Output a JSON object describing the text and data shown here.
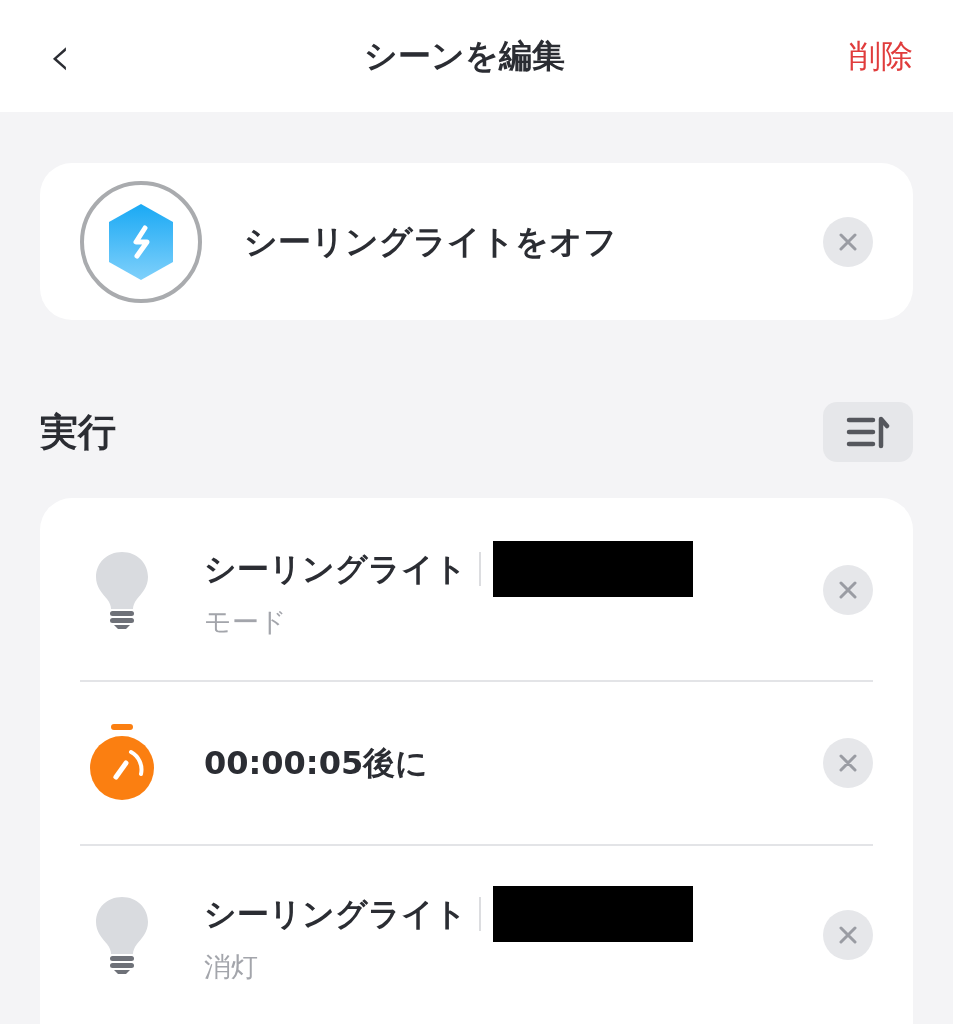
{
  "header": {
    "back": "‹",
    "title": "シーンを編集",
    "delete": "削除"
  },
  "scene": {
    "name": "シーリングライトをオフ"
  },
  "section": {
    "title": "実行"
  },
  "actions": [
    {
      "kind": "device",
      "title": "シーリングライト",
      "subtitle": "モード",
      "redacted": true
    },
    {
      "kind": "delay",
      "title": "00:00:05後に"
    },
    {
      "kind": "device",
      "title": "シーリングライト",
      "subtitle": "消灯",
      "redacted": true
    }
  ]
}
